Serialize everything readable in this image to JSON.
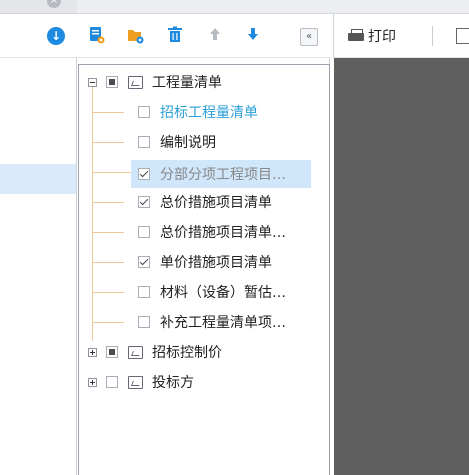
{
  "colors": {
    "accent": "#1e8be0",
    "selected_row": "#cfe6fb",
    "link_text": "#2a9fd8",
    "tree_line": "#f0c89a",
    "preview_bg": "#5f5f5f"
  },
  "left_panel": {
    "download_icon": "download-circle-icon",
    "close_icon": "close-circle-icon"
  },
  "tree_toolbar": {
    "icons": [
      "add-file-icon",
      "add-folder-icon",
      "delete-icon",
      "move-up-icon",
      "move-down-icon"
    ],
    "collapse_label": "«"
  },
  "right_toolbar": {
    "print_label": "打印"
  },
  "tree": {
    "root": {
      "label": "工程量清单",
      "expanded": true,
      "check": "partial"
    },
    "children": [
      {
        "label": "招标工程量清单",
        "check": "unchecked",
        "style": "link"
      },
      {
        "label": "编制说明",
        "check": "unchecked",
        "style": "normal"
      },
      {
        "label": "分部分项工程项目…",
        "check": "checked",
        "style": "selected"
      },
      {
        "label": "总价措施项目清单",
        "check": "checked",
        "style": "normal"
      },
      {
        "label": "总价措施项目清单…",
        "check": "unchecked",
        "style": "normal"
      },
      {
        "label": "单价措施项目清单",
        "check": "checked",
        "style": "normal"
      },
      {
        "label": "材料（设备）暂估…",
        "check": "unchecked",
        "style": "normal"
      },
      {
        "label": "补充工程量清单项…",
        "check": "unchecked",
        "style": "normal"
      }
    ],
    "other_roots": [
      {
        "label": "招标控制价",
        "expanded": false,
        "check": "partial"
      },
      {
        "label": "投标方",
        "expanded": false,
        "check": "unchecked"
      }
    ]
  }
}
